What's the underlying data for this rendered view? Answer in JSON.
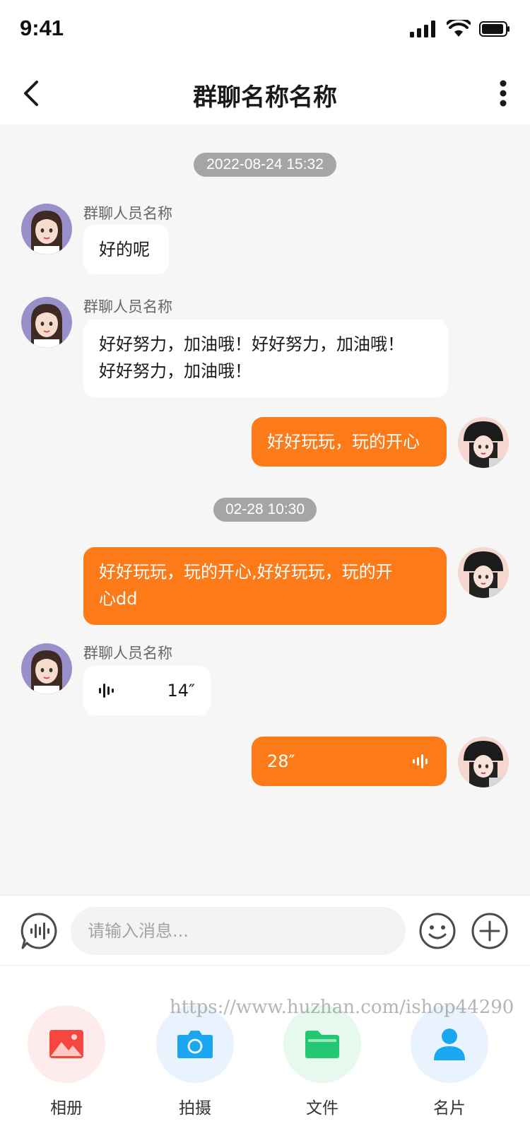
{
  "status_bar": {
    "time": "9:41"
  },
  "nav": {
    "title": "群聊名称名称"
  },
  "messages": {
    "time1": "2022-08-24 15:32",
    "m1_sender": "群聊人员名称",
    "m1_text": "好的呢",
    "m2_sender": "群聊人员名称",
    "m2_line1": "好好努力，加油哦！好好努力，加油哦！",
    "m2_line2": "好好努力，加油哦！",
    "m3_text": "好好玩玩，玩的开心",
    "time2": "02-28 10:30",
    "m4_line1": "好好玩玩，玩的开心,好好玩玩，玩的开",
    "m4_line2": "心dd",
    "m5_sender": "群聊人员名称",
    "m5_duration": "14″",
    "m6_duration": "28″"
  },
  "input": {
    "placeholder": "请输入消息..."
  },
  "tools": [
    {
      "label": "相册",
      "icon": "image-icon"
    },
    {
      "label": "拍摄",
      "icon": "camera-icon"
    },
    {
      "label": "文件",
      "icon": "folder-icon"
    },
    {
      "label": "名片",
      "icon": "contact-card-icon"
    }
  ],
  "watermark": "https://www.huzhan.com/ishop44290",
  "colors": {
    "accent": "#fd7a19",
    "chat_bg": "#f6f6f6",
    "time_chip": "#a5a5a5"
  }
}
